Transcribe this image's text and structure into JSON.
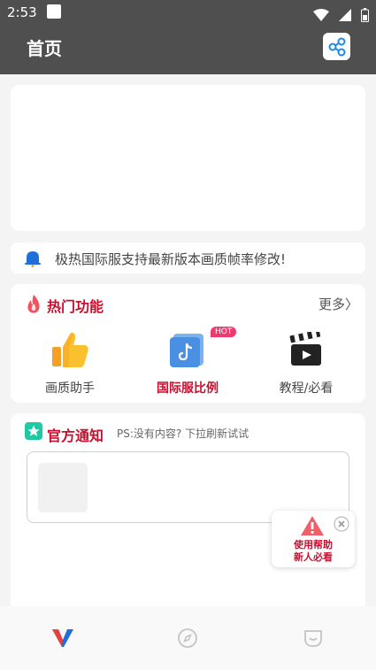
{
  "status_bar": {
    "time": "2:53"
  },
  "header": {
    "title": "首页"
  },
  "notice": {
    "text": "极热国际服支持最新版本画质帧率修改!"
  },
  "hot_functions": {
    "title": "热门功能",
    "more": "更多〉",
    "badge": "HOT",
    "items": [
      {
        "label": "画质助手",
        "icon": "thumbs-up-icon"
      },
      {
        "label": "国际服比例",
        "icon": "tiktok-app-icon",
        "active": true
      },
      {
        "label": "教程/必看",
        "icon": "clapperboard-icon"
      }
    ]
  },
  "official": {
    "title": "官方通知",
    "subtitle": "PS:没有内容? 下拉刷新试试"
  },
  "help": {
    "line1": "使用帮助",
    "line2": "新人必看"
  },
  "colors": {
    "accent": "#c8102e",
    "header": "#4f4f4f",
    "badge": "#ef3a6f"
  }
}
